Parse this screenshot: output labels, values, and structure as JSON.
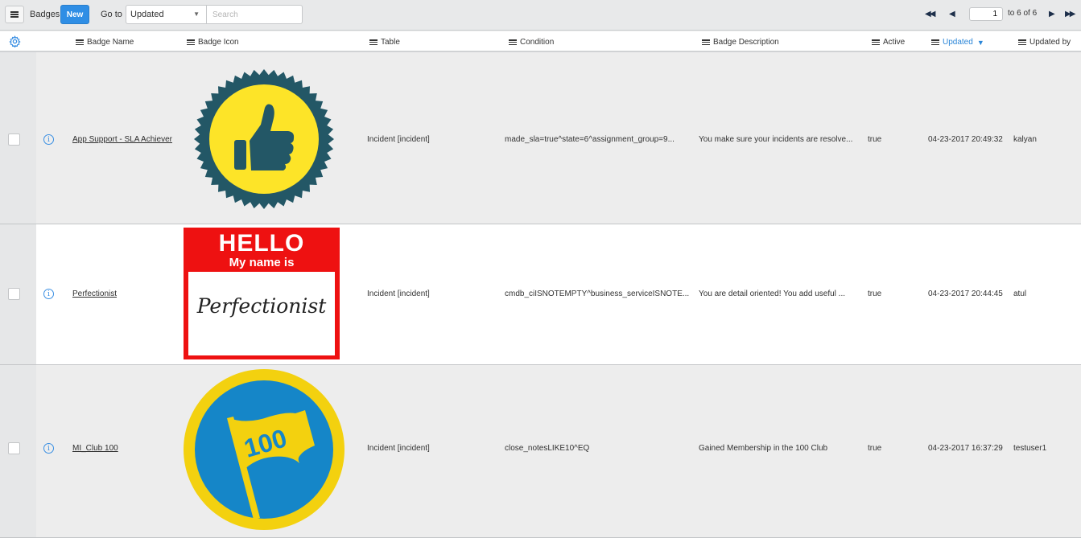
{
  "toolbar": {
    "title": "Badges",
    "new_label": "New",
    "goto_label": "Go to",
    "goto_selected": "Updated",
    "search_placeholder": "Search",
    "search_value": ""
  },
  "pager": {
    "current_page_input": "1",
    "range_text": "to 6 of 6"
  },
  "columns": [
    {
      "label": "Badge Name"
    },
    {
      "label": "Badge Icon"
    },
    {
      "label": "Table"
    },
    {
      "label": "Condition"
    },
    {
      "label": "Badge Description"
    },
    {
      "label": "Active"
    },
    {
      "label": "Updated",
      "sorted": "descending"
    },
    {
      "label": "Updated by"
    }
  ],
  "rows": [
    {
      "name": "App Support - SLA Achiever",
      "icon": "thumbs-up-seal-badge",
      "table": "Incident [incident]",
      "condition": "made_sla=true^state=6^assignment_group=9...",
      "description": "You make sure your incidents are resolve...",
      "active": "true",
      "updated": "04-23-2017 20:49:32",
      "updated_by": "kalyan"
    },
    {
      "name": "Perfectionist",
      "icon": "hello-name-tag-badge",
      "icon_text": {
        "line1": "HELLO",
        "line2": "My name is",
        "name": "Perfectionist"
      },
      "table": "Incident [incident]",
      "condition": "cmdb_ciISNOTEMPTY^business_serviceISNOTE...",
      "description": "You are detail oriented! You add useful ...",
      "active": "true",
      "updated": "04-23-2017 20:44:45",
      "updated_by": "atul"
    },
    {
      "name": "MI_Club 100",
      "icon": "flag-100-badge",
      "icon_text": {
        "flag": "100"
      },
      "table": "Incident [incident]",
      "condition": "close_notesLIKE10^EQ",
      "description": "Gained Membership in the 100 Club",
      "active": "true",
      "updated": "04-23-2017 16:37:29",
      "updated_by": "testuser1"
    }
  ],
  "colors": {
    "accent_blue": "#2f8ee5",
    "sorted_column": "#2b86d8",
    "seal_dark": "#235766",
    "seal_yellow": "#fde428",
    "tag_red": "#ee1111",
    "club_blue": "#1586c8",
    "club_yellow": "#f3d10f"
  }
}
